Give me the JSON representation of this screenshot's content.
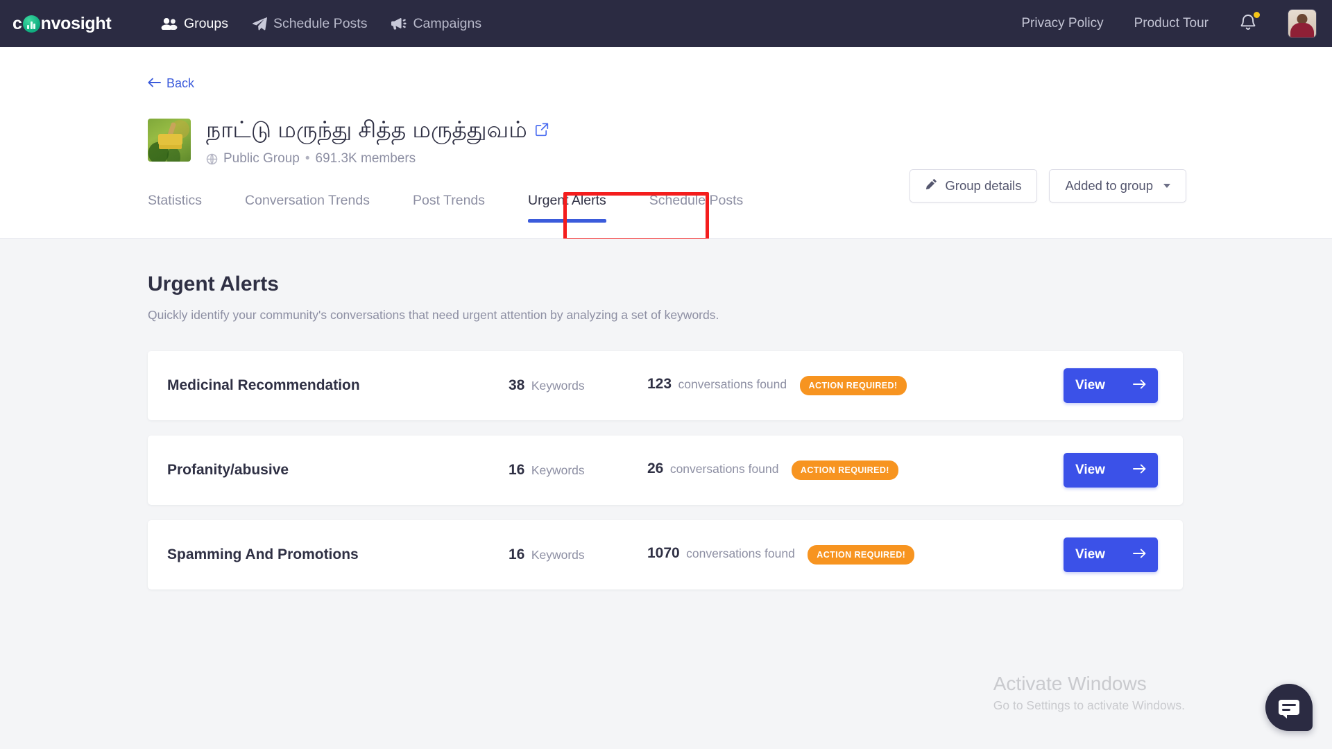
{
  "navbar": {
    "logo": {
      "prefix": "c",
      "suffix": "nvosight",
      "icon": "logo-bars-icon"
    },
    "links": [
      {
        "label": "Groups",
        "icon": "people-icon",
        "active": true
      },
      {
        "label": "Schedule Posts",
        "icon": "paper-plane-icon",
        "active": false
      },
      {
        "label": "Campaigns",
        "icon": "megaphone-icon",
        "active": false
      }
    ],
    "right_links": [
      {
        "label": "Privacy Policy"
      },
      {
        "label": "Product Tour"
      }
    ],
    "notifications_icon": "bell-icon",
    "has_notification_badge": true,
    "avatar_icon": "user-avatar"
  },
  "header": {
    "back_label": "Back",
    "back_icon": "arrow-left-icon",
    "group_name": "நாட்டு மருந்து சித்த மருத்துவம்",
    "external_link_icon": "external-link-icon",
    "privacy_icon": "globe-icon",
    "privacy_label": "Public Group",
    "separator": "•",
    "members_label": "691.3K members",
    "group_details_button": "Group details",
    "group_details_icon": "pencil-icon",
    "membership_button": "Added to group",
    "membership_caret_icon": "chevron-down-icon"
  },
  "tabs": [
    {
      "label": "Statistics",
      "active": false
    },
    {
      "label": "Conversation Trends",
      "active": false
    },
    {
      "label": "Post Trends",
      "active": false
    },
    {
      "label": "Urgent Alerts",
      "active": true
    },
    {
      "label": "Schedule Posts",
      "active": false
    }
  ],
  "main": {
    "title": "Urgent Alerts",
    "subtitle": "Quickly identify your community's conversations that need urgent attention by analyzing a set of keywords.",
    "keywords_unit": "Keywords",
    "conversations_unit": "conversations found",
    "badge_label": "ACTION REQUIRED!",
    "view_button_label": "View",
    "view_button_icon": "arrow-right-icon",
    "alerts": [
      {
        "name": "Medicinal Recommendation",
        "keywords": "38",
        "conversations": "123"
      },
      {
        "name": "Profanity/abusive",
        "keywords": "16",
        "conversations": "26"
      },
      {
        "name": "Spamming And Promotions",
        "keywords": "16",
        "conversations": "1070"
      }
    ]
  },
  "watermark": {
    "line1": "Activate Windows",
    "line2": "Go to Settings to activate Windows."
  },
  "chat_fab": {
    "icon": "chat-bubble-icon"
  },
  "colors": {
    "navbar_bg": "#2b2b42",
    "accent_blue": "#3b51e8",
    "tab_active_blue": "#3b5bdb",
    "badge_orange": "#f79420",
    "highlight_red": "#f41d1d",
    "page_bg": "#f4f5f7",
    "logo_green": "#13b183"
  }
}
